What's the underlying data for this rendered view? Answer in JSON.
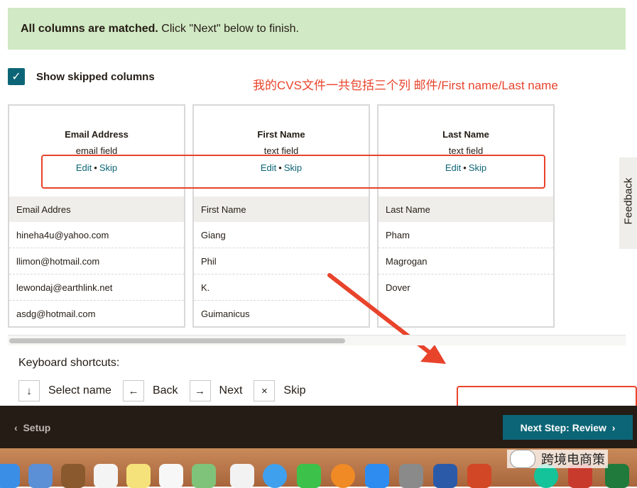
{
  "banner": {
    "bold": "All columns are matched.",
    "rest": " Click \"Next\" below to finish."
  },
  "show_skipped": {
    "label": "Show skipped columns",
    "checked": true
  },
  "annotation": "我的CVS文件一共包括三个列 邮件/First name/Last name",
  "columns": [
    {
      "name": "Email Address",
      "type": "email field",
      "edit": "Edit",
      "skip": "Skip",
      "header": "Email Addres",
      "rows": [
        "hineha4u@yahoo.com",
        "llimon@hotmail.com",
        "lewondaj@earthlink.net",
        "asdg@hotmail.com"
      ]
    },
    {
      "name": "First Name",
      "type": "text field",
      "edit": "Edit",
      "skip": "Skip",
      "header": "First Name",
      "rows": [
        "Giang",
        "Phil",
        "K.",
        "Guimanicus"
      ]
    },
    {
      "name": "Last Name",
      "type": "text field",
      "edit": "Edit",
      "skip": "Skip",
      "header": "Last Name",
      "rows": [
        "Pham",
        "Magrogan",
        "Dover"
      ]
    }
  ],
  "keyboard": {
    "title": "Keyboard shortcuts:",
    "items": [
      {
        "key": "↓",
        "label": "Select name"
      },
      {
        "key": "←",
        "label": "Back"
      },
      {
        "key": "→",
        "label": "Next"
      },
      {
        "key": "×",
        "label": "Skip"
      }
    ]
  },
  "footer": {
    "back_label": "Setup",
    "next_label": "Next Step: Review"
  },
  "feedback_label": "Feedback",
  "watermark": "跨境电商策",
  "colors": {
    "accent": "#0c6576",
    "banner_bg": "#d1e9c4",
    "annotation": "#e8432b",
    "footer_bg": "#241c15"
  }
}
